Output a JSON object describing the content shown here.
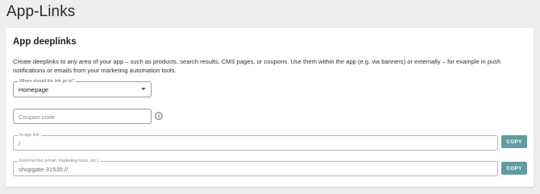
{
  "page": {
    "title": "App-Links"
  },
  "card": {
    "title": "App deeplinks",
    "description": "Create deeplinks to any area of your app – such as products, search results, CMS pages, or coupons. Use them within the app (e.g. via banners) or externally – for example in push notifications or emails from your marketing automation tools."
  },
  "link_target": {
    "label": "Where should the link go to?",
    "value": "Homepage",
    "icon": "chevron-down-icon"
  },
  "coupon": {
    "placeholder": "Coupon code",
    "info_icon": "info-icon"
  },
  "in_app_link": {
    "label": "In-app link",
    "value": "/",
    "copy_label": "COPY"
  },
  "external_link": {
    "label": "External link (email, marketing tools, etc.)",
    "value": "shopgate-31535://",
    "copy_label": "COPY"
  },
  "colors": {
    "background": "#eeeeee",
    "card": "#ffffff",
    "accent": "#5f9ea0"
  }
}
